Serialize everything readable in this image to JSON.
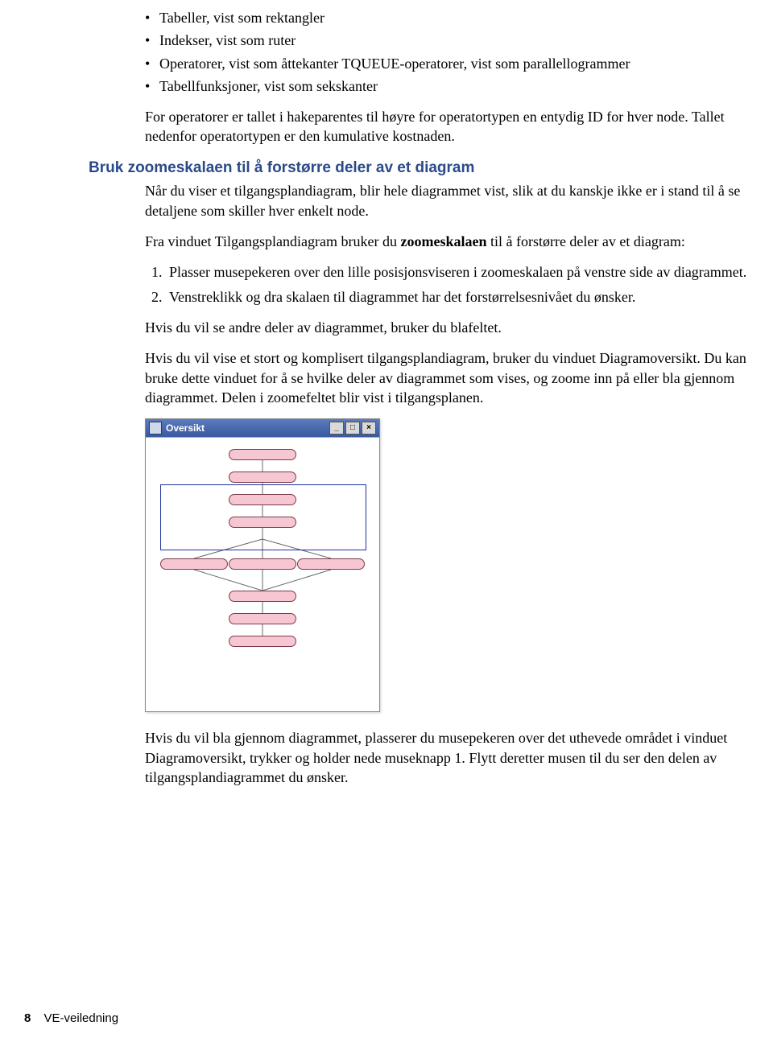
{
  "bullets": [
    "Tabeller, vist som rektangler",
    "Indekser, vist som ruter",
    "Operatorer, vist som åttekanter TQUEUE-operatorer, vist som parallellogrammer",
    "Tabellfunksjoner, vist som sekskanter"
  ],
  "para_operator_id": "For operatorer er tallet i hakeparentes til høyre for operatortypen en entydig ID for hver node. Tallet nedenfor operatortypen er den kumulative kostnaden.",
  "section_heading": "Bruk zoomeskalaen til å forstørre deler av et diagram",
  "para_intro": "Når du viser et tilgangsplandiagram, blir hele diagrammet vist, slik at du kanskje ikke er i stand til å se detaljene som skiller hver enkelt node.",
  "para_use_pre": "Fra vinduet Tilgangsplandiagram bruker du ",
  "para_use_bold": "zoomeskalaen",
  "para_use_post": " til å forstørre deler av et diagram:",
  "steps": [
    "Plasser musepekeren over den lille posisjonsviseren i zoomeskalaen på venstre side av diagrammet.",
    "Venstreklikk og dra skalaen til diagrammet har det forstørrelsesnivået du ønsker."
  ],
  "para_blafeltet": "Hvis du vil se andre deler av diagrammet, bruker du blafeltet.",
  "para_oversikt": "Hvis du vil vise et stort og komplisert tilgangsplandiagram, bruker du vinduet Diagramoversikt. Du kan bruke dette vinduet for å se hvilke deler av diagrammet som vises, og zoome inn på eller bla gjennom diagrammet. Delen i zoomefeltet blir vist i tilgangsplanen.",
  "window": {
    "title": "Oversikt",
    "nodes": [
      "",
      "",
      "",
      "",
      "",
      "",
      "",
      "",
      "",
      "",
      ""
    ]
  },
  "para_scroll": "Hvis du vil bla gjennom diagrammet, plasserer du musepekeren over det uthevede området i vinduet Diagramoversikt, trykker og holder nede museknapp 1. Flytt deretter musen til du ser den delen av tilgangsplandiagrammet du ønsker.",
  "footer": {
    "page": "8",
    "title": "VE-veiledning"
  }
}
